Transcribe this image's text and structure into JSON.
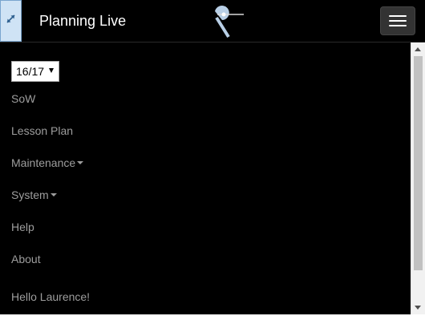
{
  "navbar": {
    "brand": "Planning Live",
    "expand_icon": "expand-arrows-icon",
    "logo_icon": "pin-flag-logo",
    "menu_icon": "hamburger-icon"
  },
  "menu": {
    "year_select": {
      "value": "16/17"
    },
    "items": [
      {
        "label": "SoW",
        "dropdown": false
      },
      {
        "label": "Lesson Plan",
        "dropdown": false
      },
      {
        "label": "Maintenance",
        "dropdown": true
      },
      {
        "label": "System",
        "dropdown": true
      },
      {
        "label": "Help",
        "dropdown": false
      },
      {
        "label": "About",
        "dropdown": false
      }
    ],
    "greeting": "Hello Laurence!"
  },
  "colors": {
    "background": "#000000",
    "nav_text": "#9d9d9d",
    "brand_text": "#ffffff",
    "expand_button": "#cfe3f5",
    "hamburger_button": "#333333"
  }
}
